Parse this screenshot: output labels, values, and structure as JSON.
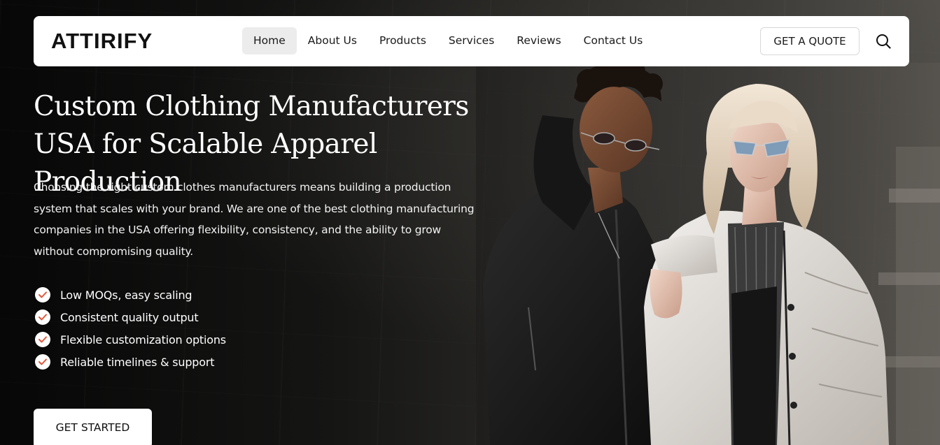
{
  "header": {
    "logo": "ATTIRIFY",
    "nav": [
      {
        "label": "Home",
        "active": true
      },
      {
        "label": "About Us"
      },
      {
        "label": "Products"
      },
      {
        "label": "Services"
      },
      {
        "label": "Reviews"
      },
      {
        "label": "Contact Us"
      }
    ],
    "quote_label": "GET A QUOTE",
    "search_icon": "search-icon"
  },
  "hero": {
    "title_line1": "Custom Clothing Manufacturers",
    "title_line2": "USA for Scalable Apparel Production",
    "description": "Choosing the right custom clothes manufacturers means building a production system that scales with your brand. We are one of the best clothing manufacturing companies in the USA offering flexibility, consistency, and the ability to grow without compromising quality.",
    "features": [
      "Low MOQs, easy scaling",
      "Consistent quality output",
      "Flexible customization options",
      "Reliable timelines & support"
    ],
    "cta_label": "GET STARTED",
    "image": "two-models-in-jackets-photo"
  },
  "colors": {
    "background": "#0d0d0d",
    "navbar": "#ffffff",
    "active_nav": "#ececec",
    "check_accent": "#e0573a",
    "text_light": "#ffffff"
  }
}
